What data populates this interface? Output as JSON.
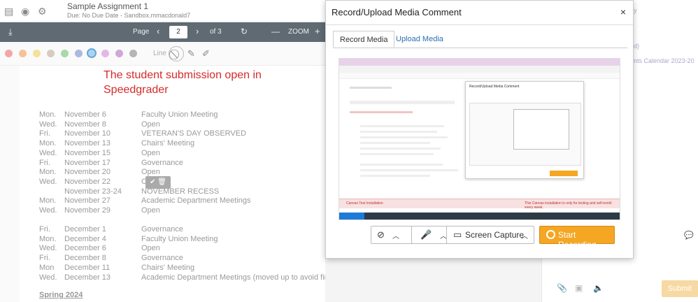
{
  "assignment": {
    "title": "Sample Assignment 1",
    "subtitle": "Due: No Due Date - Sandbox.mmacdonald7"
  },
  "toolbar": {
    "page_label": "Page",
    "page_value": "2",
    "page_total": "of 3",
    "zoom_label": "ZOOM"
  },
  "colorbar": {
    "line_label": "Line",
    "colors": [
      "#f4a6a6",
      "#f6c29b",
      "#f4e29b",
      "#d6ccbf",
      "#a8d9a8",
      "#a9b9e0",
      "#a8d6f0",
      "#e3b8e6",
      "#d0a8d8",
      "#b5b5b5"
    ]
  },
  "note": "The student submission open in Speedgrader",
  "schedule_nov": [
    {
      "day": "Mon.",
      "date": "November 6",
      "event": "Faculty Union Meeting"
    },
    {
      "day": "Wed.",
      "date": "November 8",
      "event": "Open"
    },
    {
      "day": "Fri.",
      "date": "November 10",
      "event": "VETERAN'S DAY OBSERVED"
    },
    {
      "day": "Mon.",
      "date": "November 13",
      "event": "Chairs' Meeting"
    },
    {
      "day": "Wed.",
      "date": "November 15",
      "event": "Open"
    },
    {
      "day": "Fri.",
      "date": "November 17",
      "event": "Governance"
    },
    {
      "day": "Mon.",
      "date": "November 20",
      "event": "Open"
    },
    {
      "day": "Wed.",
      "date": "November 22",
      "event": "C"
    },
    {
      "day": "",
      "date": "November 23-24",
      "event": "NOVEMBER RECESS"
    },
    {
      "day": "Mon.",
      "date": "November 27",
      "event": "Academic Department Meetings"
    },
    {
      "day": "Wed.",
      "date": "November 29",
      "event": "Open"
    }
  ],
  "schedule_dec": [
    {
      "day": "Fri.",
      "date": "December 1",
      "event": "Governance"
    },
    {
      "day": "Mon.",
      "date": "December 4",
      "event": "Faculty Union Meeting"
    },
    {
      "day": "Wed.",
      "date": "December 6",
      "event": "Open"
    },
    {
      "day": "Fri.",
      "date": "December 8",
      "event": "Governance"
    },
    {
      "day": "Mon",
      "date": "December 11",
      "event": "Chairs' Meeting"
    },
    {
      "day": "Wed.",
      "date": "December 13",
      "event": "Academic Department Meetings (moved up to avoid finals week)"
    }
  ],
  "spring_heading": "Spring 2024",
  "right_panel": {
    "muted_text_1": "y",
    "muted_text_2": "d)",
    "muted_text_3": "nts Calendar 2023-20",
    "submit_label": "Submit"
  },
  "modal": {
    "title": "Record/Upload Media Comment",
    "close_glyph": "×",
    "tab_record": "Record Media",
    "tab_upload": "Upload Media",
    "screen_capture_label": "Screen Capture",
    "start_recording_label": "Start Recording",
    "preview": {
      "inner_title": "Record/Upload Media Comment",
      "red_banner_left": "Canvas Test Installation",
      "red_banner_right": "This Canvas installation is only for testing and self-enroll every week.",
      "progress": 0.09
    }
  }
}
